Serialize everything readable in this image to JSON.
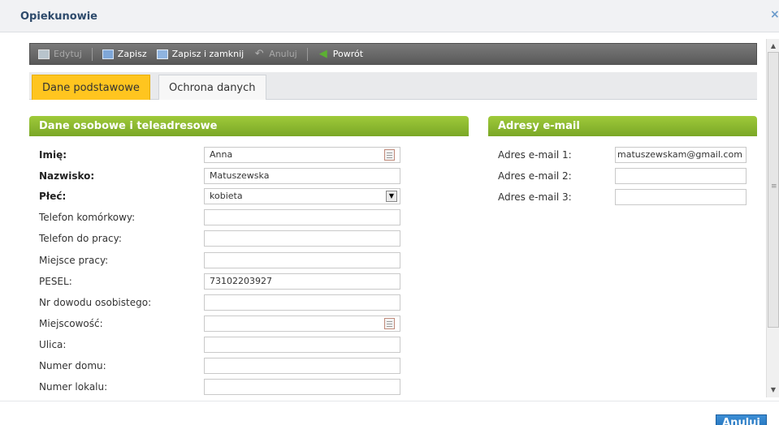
{
  "window": {
    "title": "Opiekunowie",
    "close_glyph": "×"
  },
  "toolbar": [
    {
      "label": "Edytuj",
      "icon": "edit-icon",
      "disabled": true
    },
    {
      "label": "Zapisz",
      "icon": "save-icon",
      "disabled": false
    },
    {
      "label": "Zapisz i zamknij",
      "icon": "save-close-icon",
      "disabled": false
    },
    {
      "label": "Anuluj",
      "icon": "undo-icon",
      "disabled": true
    },
    {
      "label": "Powrót",
      "icon": "back-arrow-icon",
      "disabled": false
    }
  ],
  "tabs": [
    {
      "label": "Dane podstawowe",
      "active": true
    },
    {
      "label": "Ochrona danych",
      "active": false
    }
  ],
  "personal": {
    "header": "Dane osobowe i teleadresowe",
    "fields": [
      {
        "label": "Imię:",
        "value": "Anna"
      },
      {
        "label": "Nazwisko:",
        "value": "Matuszewska"
      },
      {
        "label": "Płeć:",
        "value": "kobieta"
      },
      {
        "label": "Telefon komórkowy:",
        "value": ""
      },
      {
        "label": "Telefon do pracy:",
        "value": ""
      },
      {
        "label": "Miejsce pracy:",
        "value": ""
      },
      {
        "label": "PESEL:",
        "value": "73102203927"
      },
      {
        "label": "Nr dowodu osobistego:",
        "value": ""
      },
      {
        "label": "Miejscowość:",
        "value": ""
      },
      {
        "label": "Ulica:",
        "value": ""
      },
      {
        "label": "Numer domu:",
        "value": ""
      },
      {
        "label": "Numer lokalu:",
        "value": ""
      }
    ]
  },
  "emails": {
    "header": "Adresy e-mail",
    "fields": [
      {
        "label": "Adres e-mail 1:",
        "value": "matuszewskam@gmail.com"
      },
      {
        "label": "Adres e-mail 2:",
        "value": ""
      },
      {
        "label": "Adres e-mail 3:",
        "value": ""
      }
    ]
  },
  "footer": {
    "cancel_label": "Anuluj"
  },
  "colors": {
    "toolbar": "#666666",
    "tab_active": "#ffc51f",
    "section_header": "#8cb830",
    "primary_button": "#2a7cc7"
  }
}
